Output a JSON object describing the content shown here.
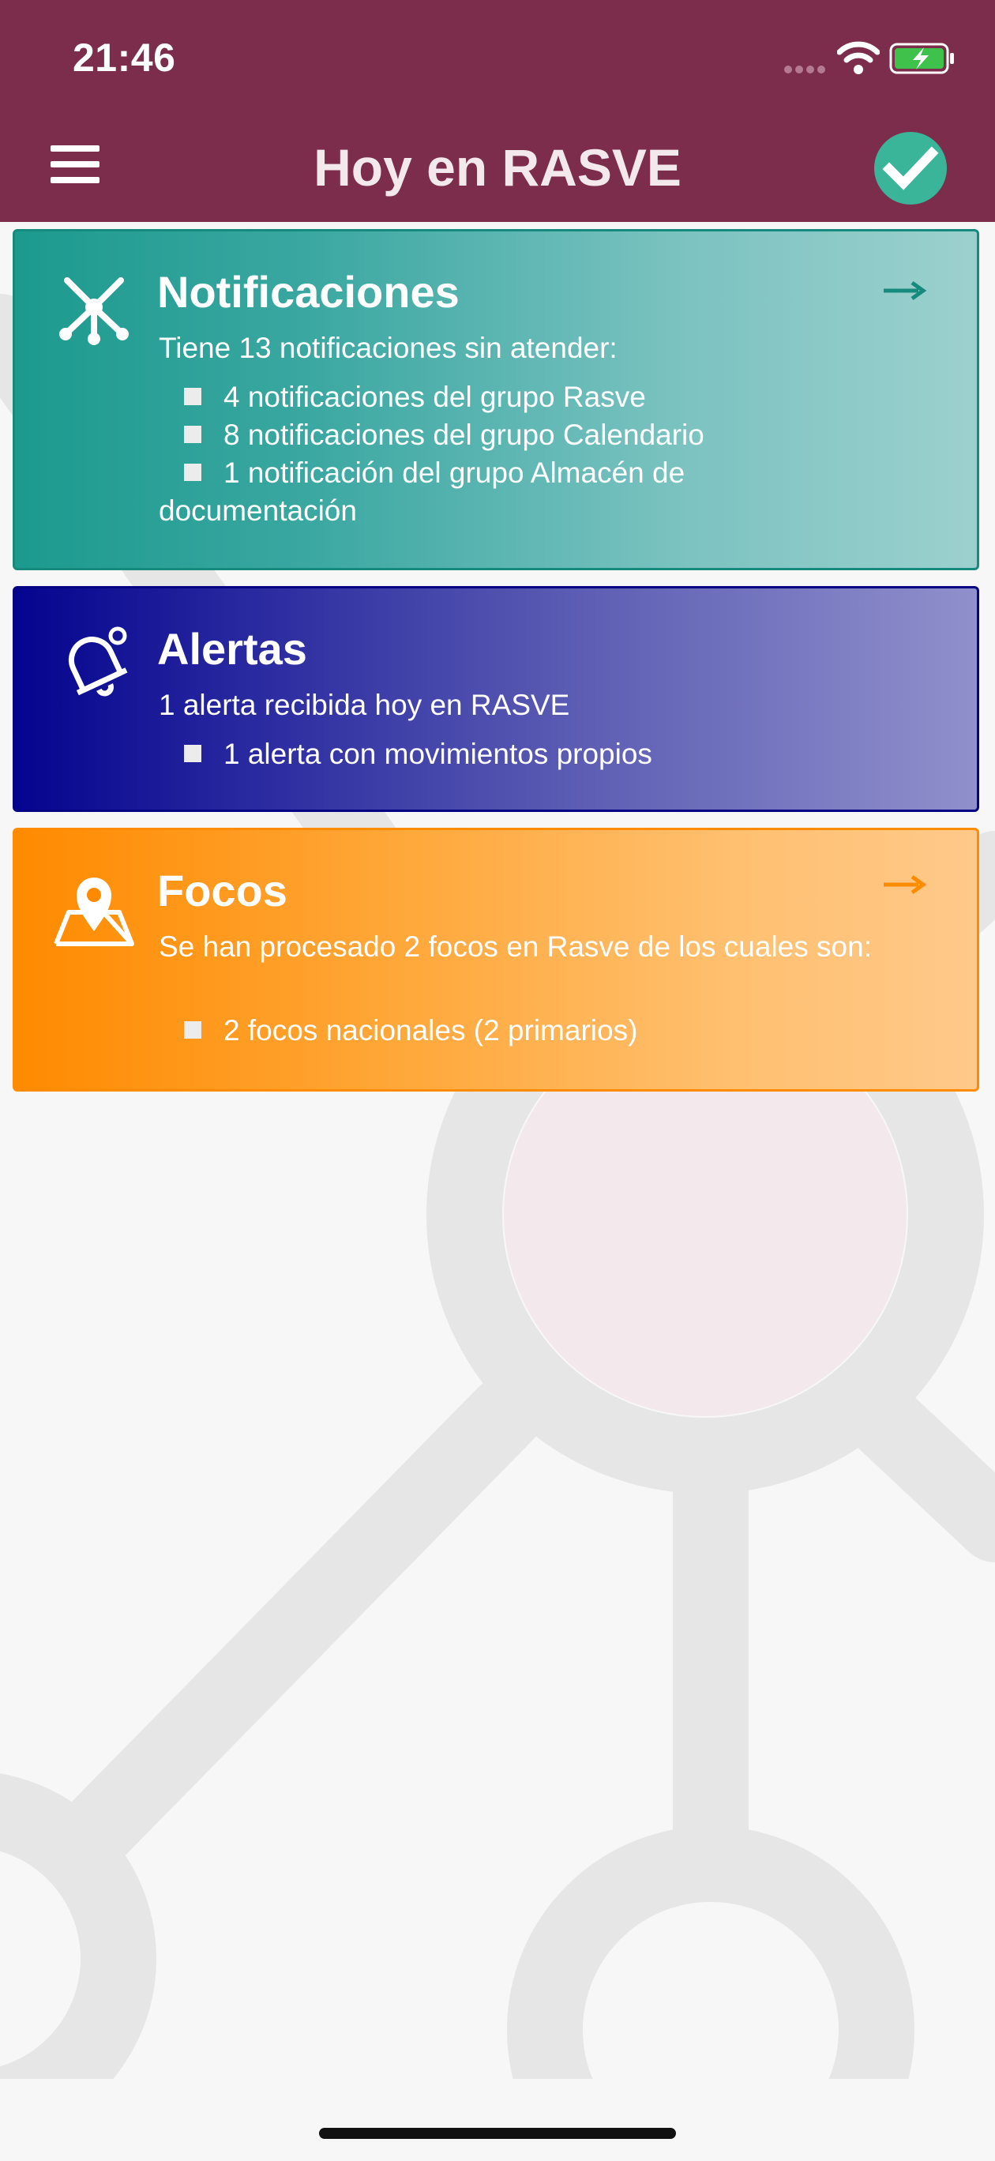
{
  "status_bar": {
    "time": "21:46"
  },
  "header": {
    "title": "Hoy en RASVE",
    "menu_icon": "hamburger-menu-icon",
    "confirm_icon": "check-circle-icon"
  },
  "cards": {
    "notificaciones": {
      "title": "Notificaciones",
      "subtitle": "Tiene 13 notificaciones sin atender:",
      "items": [
        "4 notificaciones del grupo Rasve",
        "8 notificaciones del grupo Calendario",
        "1 notificación del grupo Almacén de",
        "documentación"
      ],
      "icon": "network-nodes-icon",
      "arrow_icon": "arrow-right-icon",
      "color": "#1c9a8e"
    },
    "alertas": {
      "title": "Alertas",
      "subtitle": "1 alerta recibida hoy en RASVE",
      "items": [
        "1 alerta con movimientos propios"
      ],
      "icon": "bell-icon",
      "color": "#04048f"
    },
    "focos": {
      "title": "Focos",
      "subtitle": "Se han procesado 2 focos en Rasve de los cuales son:",
      "items": [
        "2 focos nacionales (2 primarios)"
      ],
      "icon": "map-pin-icon",
      "arrow_icon": "arrow-right-icon",
      "color": "#ff8a00"
    }
  },
  "colors": {
    "header_bg": "#7b2d4b",
    "check_green": "#3ab59a",
    "page_bg": "#f7f7f7"
  }
}
